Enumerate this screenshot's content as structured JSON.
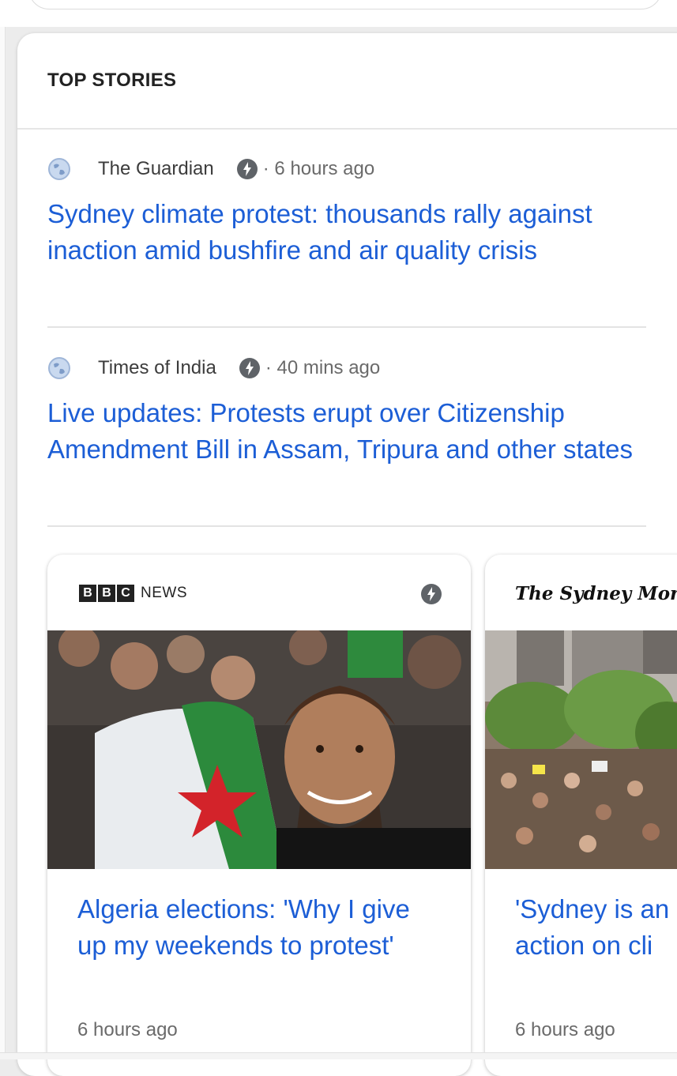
{
  "top_stories": {
    "title": "TOP STORIES",
    "stories": [
      {
        "source": "The Guardian",
        "time": "· 6 hours ago",
        "headline": "Sydney climate protest: thousands rally against inaction amid bushfire and air quality crisis"
      },
      {
        "source": "Times of India",
        "time": "· 40 mins ago",
        "headline": "Live updates: Protests erupt over Citizenship Amendment Bill in Assam, Tripura and other states"
      }
    ],
    "carousel": [
      {
        "logo_letters": [
          "B",
          "B",
          "C"
        ],
        "logo_text": "NEWS",
        "headline": "Algeria elections: 'Why I give up my weekends to protest'",
        "time": "6 hours ago"
      },
      {
        "logo_text": "The Sydney Morning",
        "headline": "'Sydney is an march to der action on cli",
        "time": "6 hours ago"
      }
    ]
  },
  "colors": {
    "link": "#1c5ed6",
    "meta_text": "#6a6a6a"
  },
  "icons": {
    "source_icon": "globe-icon",
    "amp_icon": "lightning-bolt-icon"
  }
}
